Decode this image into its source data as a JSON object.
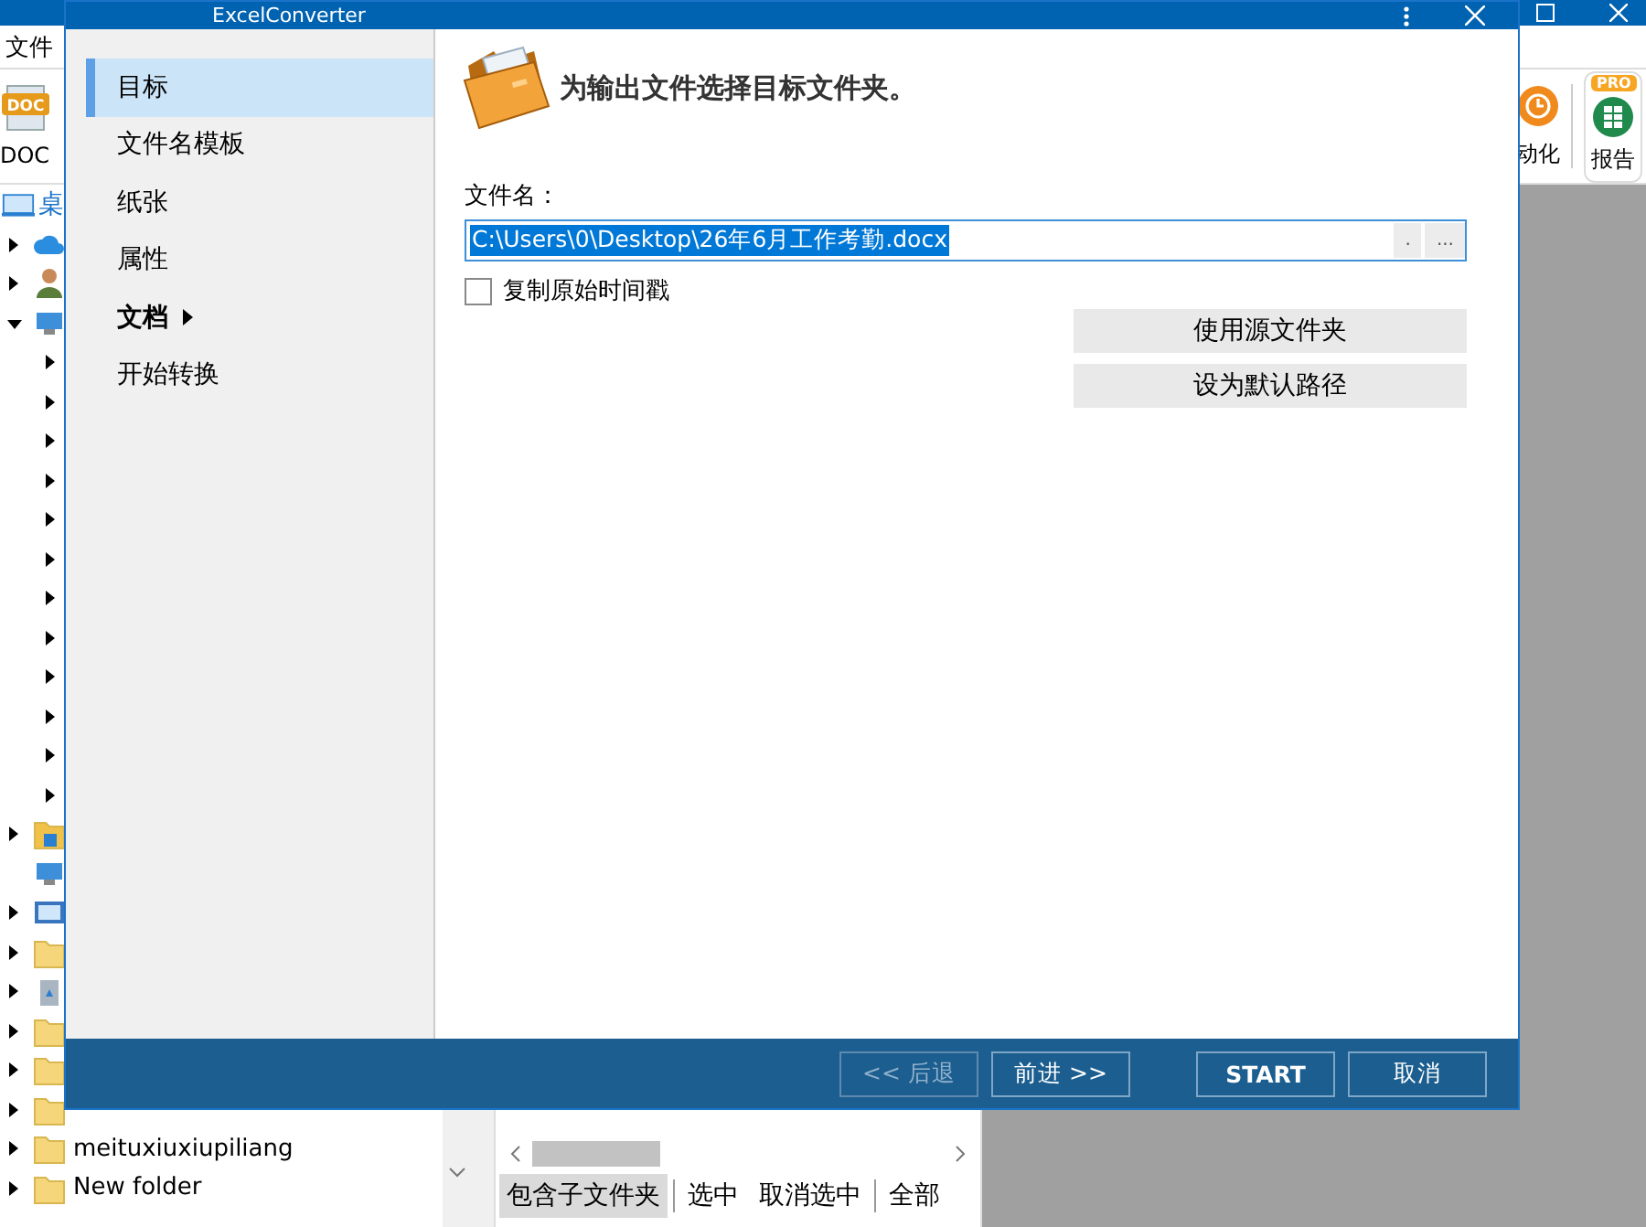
{
  "background_app": {
    "menu": [
      "文件"
    ],
    "ribbon": {
      "left": [
        {
          "kind": "doc",
          "icon_text": "DOC",
          "label": "DOC"
        }
      ],
      "right": [
        {
          "kind": "clock",
          "label": "动化"
        },
        {
          "kind": "sheet",
          "label": "报告",
          "badge": "PRO"
        }
      ]
    },
    "tree": {
      "root": {
        "label": "桌"
      },
      "items": [
        {
          "kind": "cloud",
          "expanded": false
        },
        {
          "kind": "person",
          "expanded": false
        },
        {
          "kind": "computer",
          "expanded": true,
          "children": [
            {
              "expanded": false
            },
            {
              "expanded": false
            },
            {
              "expanded": false
            },
            {
              "expanded": false
            },
            {
              "expanded": false
            },
            {
              "expanded": false
            },
            {
              "expanded": false
            },
            {
              "expanded": false
            },
            {
              "expanded": false
            },
            {
              "expanded": false
            },
            {
              "expanded": false
            },
            {
              "expanded": false
            }
          ]
        },
        {
          "kind": "home-folder",
          "expanded": false
        },
        {
          "kind": "network"
        },
        {
          "kind": "control-panel",
          "expanded": false
        },
        {
          "kind": "folder",
          "expanded": false
        },
        {
          "kind": "recycle",
          "expanded": false
        },
        {
          "kind": "folder",
          "expanded": false
        },
        {
          "kind": "folder",
          "expanded": false
        },
        {
          "kind": "folder",
          "expanded": false
        },
        {
          "kind": "folder",
          "expanded": false,
          "label": "meituxiuxiupiliang"
        },
        {
          "kind": "folder",
          "expanded": false,
          "label": "New folder"
        }
      ]
    },
    "bottom_toolbar": [
      {
        "label": "包含子文件夹",
        "selected": true
      },
      {
        "label": "选中",
        "selected": false
      },
      {
        "label": "取消选中",
        "selected": false
      },
      {
        "label": "全部",
        "selected": false
      }
    ]
  },
  "dialog": {
    "title": "ExcelConverter",
    "nav": [
      {
        "label": "目标",
        "selected": true,
        "submenu": false
      },
      {
        "label": "文件名模板",
        "selected": false,
        "submenu": false
      },
      {
        "label": "纸张",
        "selected": false,
        "submenu": false
      },
      {
        "label": "属性",
        "selected": false,
        "submenu": false
      },
      {
        "label": "文档",
        "selected": false,
        "submenu": true
      },
      {
        "label": "开始转换",
        "selected": false,
        "submenu": false
      }
    ],
    "heading": "为输出文件选择目标文件夹。",
    "file_label": "文件名：",
    "file_field": {
      "value": "C:\\Users\\0\\Desktop\\26年6月工作考勤.docx",
      "selected": true,
      "buttons": [
        ".",
        "..."
      ]
    },
    "copy_timestamp": {
      "label": "复制原始时间戳",
      "checked": false
    },
    "actions": [
      "使用源文件夹",
      "设为默认路径"
    ],
    "footer": [
      {
        "label": "<< 后退",
        "disabled": true,
        "primary": false
      },
      {
        "label": "前进 >>",
        "disabled": false,
        "primary": false
      },
      {
        "label": "START",
        "disabled": false,
        "primary": true
      },
      {
        "label": "取消",
        "disabled": false,
        "primary": false
      }
    ]
  }
}
